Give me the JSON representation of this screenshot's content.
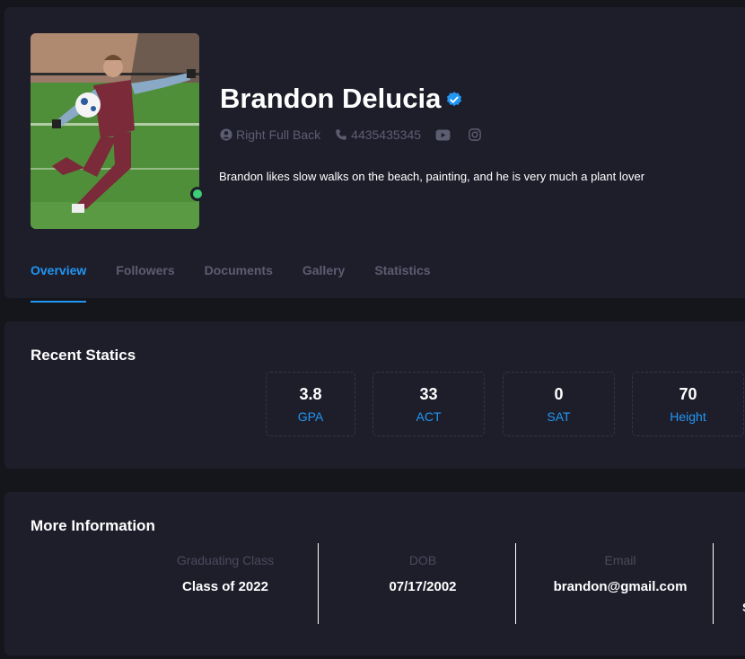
{
  "profile": {
    "name": "Brandon Delucia",
    "position": "Right Full Back",
    "phone": "4435435345",
    "bio": "Brandon likes slow walks on the beach, painting, and he is very much a plant lover",
    "online": true,
    "icons": [
      "verified-badge-icon",
      "user-circle-icon",
      "phone-icon",
      "youtube-icon",
      "instagram-icon"
    ]
  },
  "tabs": [
    {
      "label": "Overview",
      "active": true
    },
    {
      "label": "Followers",
      "active": false
    },
    {
      "label": "Documents",
      "active": false
    },
    {
      "label": "Gallery",
      "active": false
    },
    {
      "label": "Statistics",
      "active": false
    }
  ],
  "recent_stats": {
    "title": "Recent Statics",
    "items": [
      {
        "value": "3.8",
        "label": "GPA"
      },
      {
        "value": "33",
        "label": "ACT"
      },
      {
        "value": "0",
        "label": "SAT"
      },
      {
        "value": "70",
        "label": "Height"
      }
    ]
  },
  "more_info": {
    "title": "More Information",
    "items": [
      {
        "label": "Graduating Class",
        "value": "Class of 2022"
      },
      {
        "label": "DOB",
        "value": "07/17/2002"
      },
      {
        "label": "Email",
        "value": "brandon@gmail.com"
      }
    ],
    "overflow_glyph": "S"
  },
  "colors": {
    "background": "#15151c",
    "card": "#1e1e2b",
    "accent": "#2196f3",
    "online": "#3ecf76",
    "muted": "#5d5d72"
  }
}
